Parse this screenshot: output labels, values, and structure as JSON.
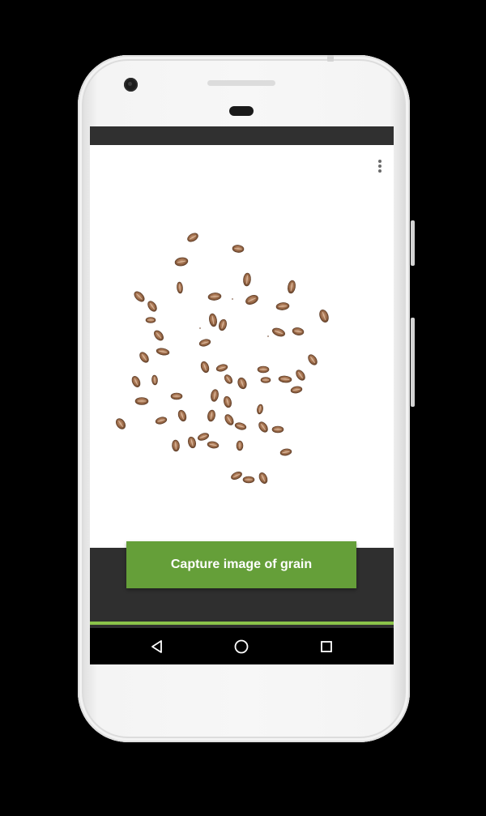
{
  "app": {
    "capture_button_label": "Capture image of grain",
    "menu_icon": "more-vert-icon"
  },
  "navigation": {
    "back_icon": "back-triangle-icon",
    "home_icon": "home-circle-icon",
    "recents_icon": "recents-square-icon"
  },
  "colors": {
    "accent_green": "#659f39",
    "progress_green": "#8bc34a",
    "status_bar": "#303030",
    "nav_bar": "#000000",
    "grain_brown": "#8a5a3b"
  }
}
